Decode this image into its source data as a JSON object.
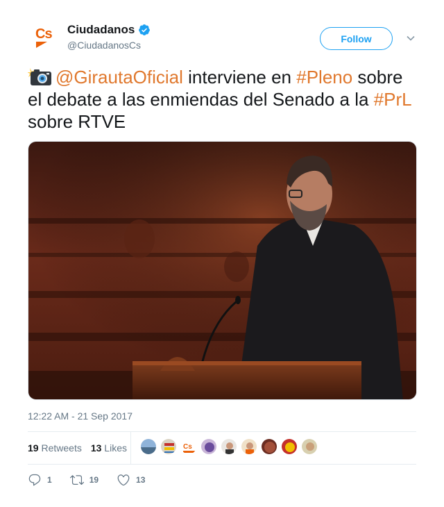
{
  "account": {
    "name": "Ciudadanos",
    "handle": "@CiudadanosCs",
    "logo_text": "Cs",
    "brand_color": "#eb6109",
    "verified": true
  },
  "follow_button": {
    "label": "Follow"
  },
  "tweet": {
    "emoji_icon": "camera-flash-icon",
    "mention": "@GirautaOficial",
    "text_1": " interviene en ",
    "hashtag_1": "#Pleno",
    "text_2": " sobre el debate a las enmiendas del Senado a la ",
    "hashtag_2": "#PrL",
    "text_3": " sobre RTVE",
    "link_color": "#e0782d"
  },
  "timestamp": "12:22 AM - 21 Sep 2017",
  "stats": {
    "retweets_count": "19",
    "retweets_label": "Retweets",
    "likes_count": "13",
    "likes_label": "Likes"
  },
  "actions": {
    "reply_count": "1",
    "retweet_count": "19",
    "like_count": "13"
  }
}
